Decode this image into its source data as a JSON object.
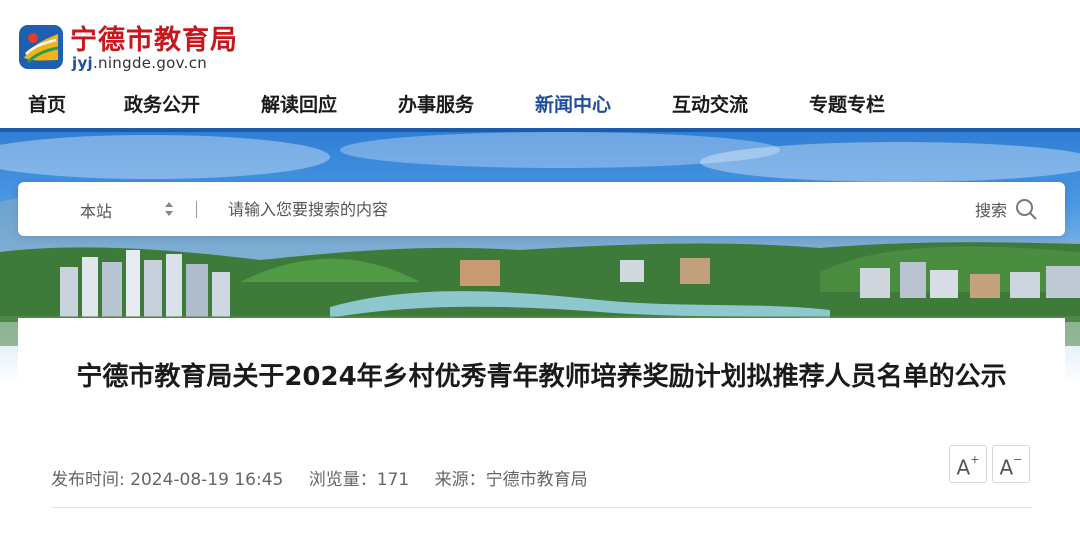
{
  "site": {
    "name": "宁德市教育局",
    "domain_prefix": "jyj",
    "domain_suffix": ".ningde.gov.cn"
  },
  "nav": {
    "items": [
      {
        "label": "首页"
      },
      {
        "label": "政务公开"
      },
      {
        "label": "解读回应"
      },
      {
        "label": "办事服务"
      },
      {
        "label": "新闻中心",
        "active": true
      },
      {
        "label": "互动交流"
      },
      {
        "label": "专题专栏"
      }
    ]
  },
  "search": {
    "scope": "本站",
    "placeholder": "请输入您要搜索的内容",
    "button_label": "搜索"
  },
  "article": {
    "title": "宁德市教育局关于2024年乡村优秀青年教师培养奖励计划拟推荐人员名单的公示",
    "publish_time": "发布时间: 2024-08-19 16:45",
    "views": "浏览量：171",
    "source": "来源：宁德市教育局",
    "font_increase": "A",
    "font_increase_sup": "+",
    "font_decrease": "A",
    "font_decrease_sup": "−"
  },
  "colors": {
    "brand_red": "#c8161d",
    "nav_active": "#1f4f96",
    "nav_rule": "#1d5aa8"
  }
}
